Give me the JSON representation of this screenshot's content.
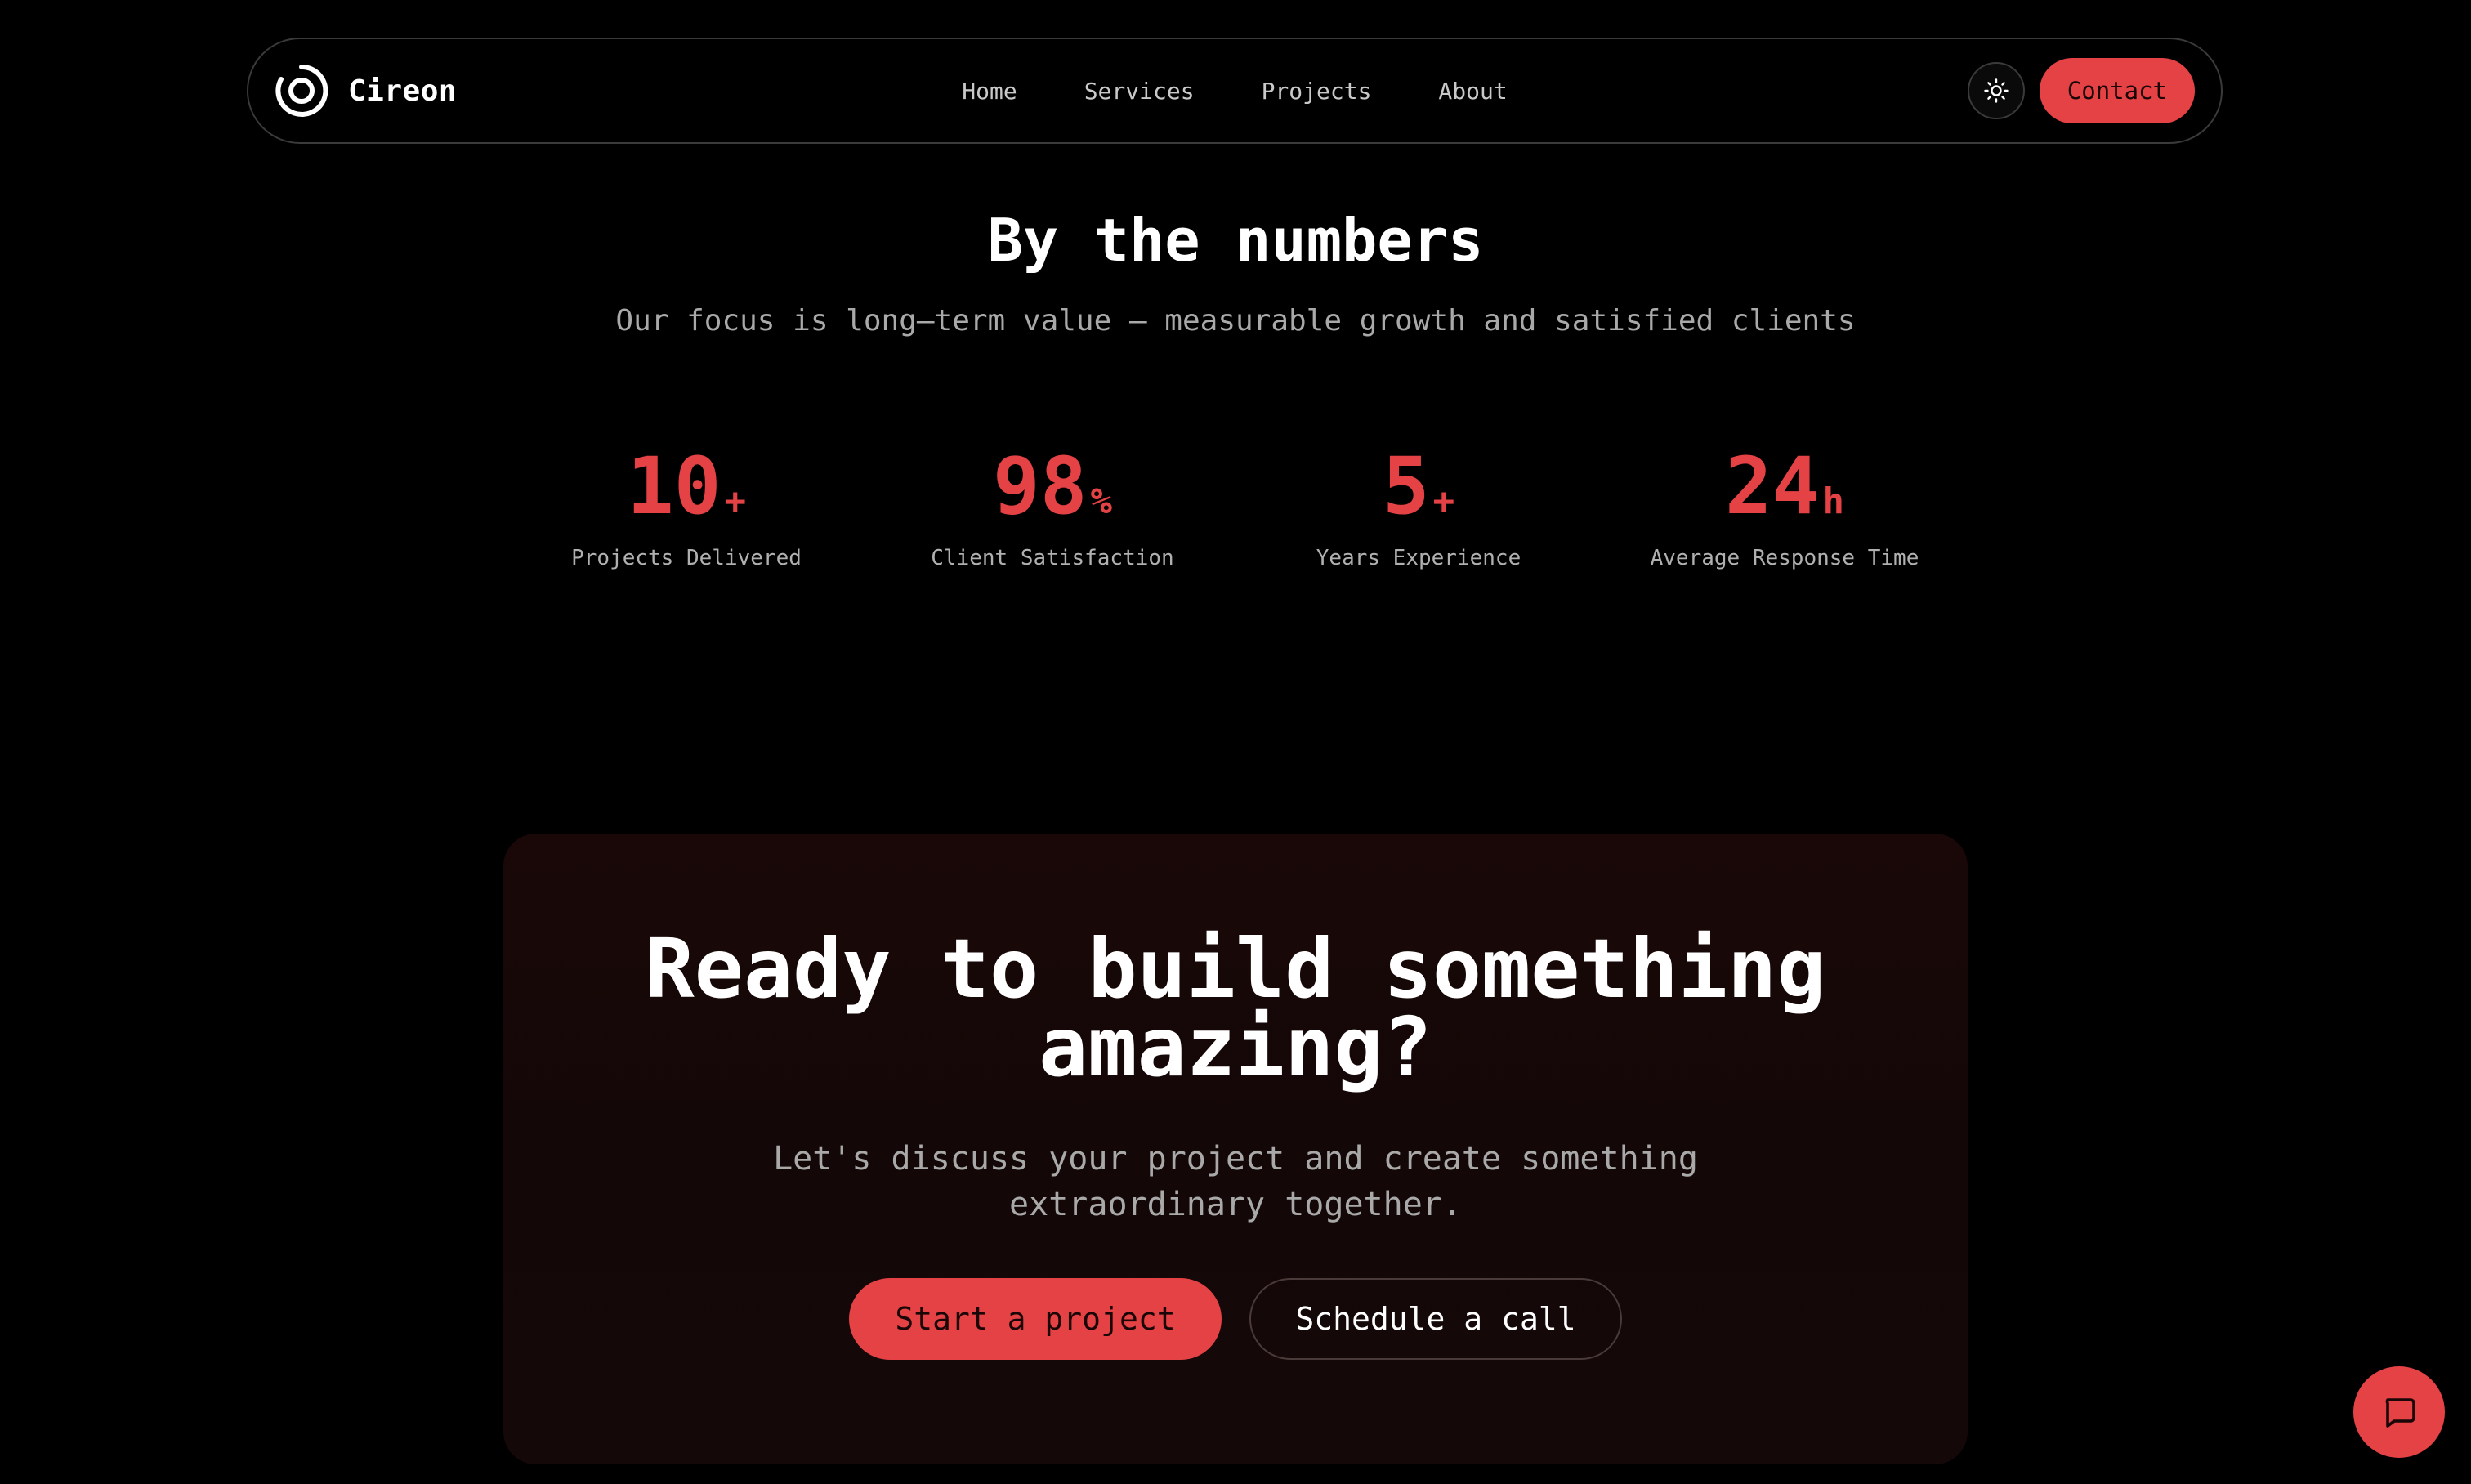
{
  "nav": {
    "brand_name": "Cireon",
    "logo_icon": "ring-logo-icon",
    "links": [
      {
        "label": "Home"
      },
      {
        "label": "Services"
      },
      {
        "label": "Projects"
      },
      {
        "label": "About"
      }
    ],
    "theme_icon": "sun-icon",
    "contact_label": "Contact"
  },
  "numbers": {
    "title": "By the numbers",
    "subtitle": "Our focus is long–term value — measurable growth and satisfied clients",
    "stats": [
      {
        "value": "10",
        "suffix": "+",
        "label": "Projects Delivered"
      },
      {
        "value": "98",
        "suffix": "%",
        "label": "Client Satisfaction"
      },
      {
        "value": "5",
        "suffix": "+",
        "label": "Years Experience"
      },
      {
        "value": "24",
        "suffix": "h",
        "label": "Average Response Time"
      }
    ]
  },
  "cta": {
    "title_line1": "Ready to build something",
    "title_line2": "amazing?",
    "text_line1": "Let's discuss your project and create something",
    "text_line2": "extraordinary together.",
    "primary_label": "Start a project",
    "secondary_label": "Schedule a call"
  },
  "chat": {
    "icon": "chat-bubble-icon"
  },
  "colors": {
    "background": "#000000",
    "accent": "#e54245",
    "card_background": "#140808",
    "text_primary": "#ffffff",
    "text_muted": "#a9a9a9"
  }
}
